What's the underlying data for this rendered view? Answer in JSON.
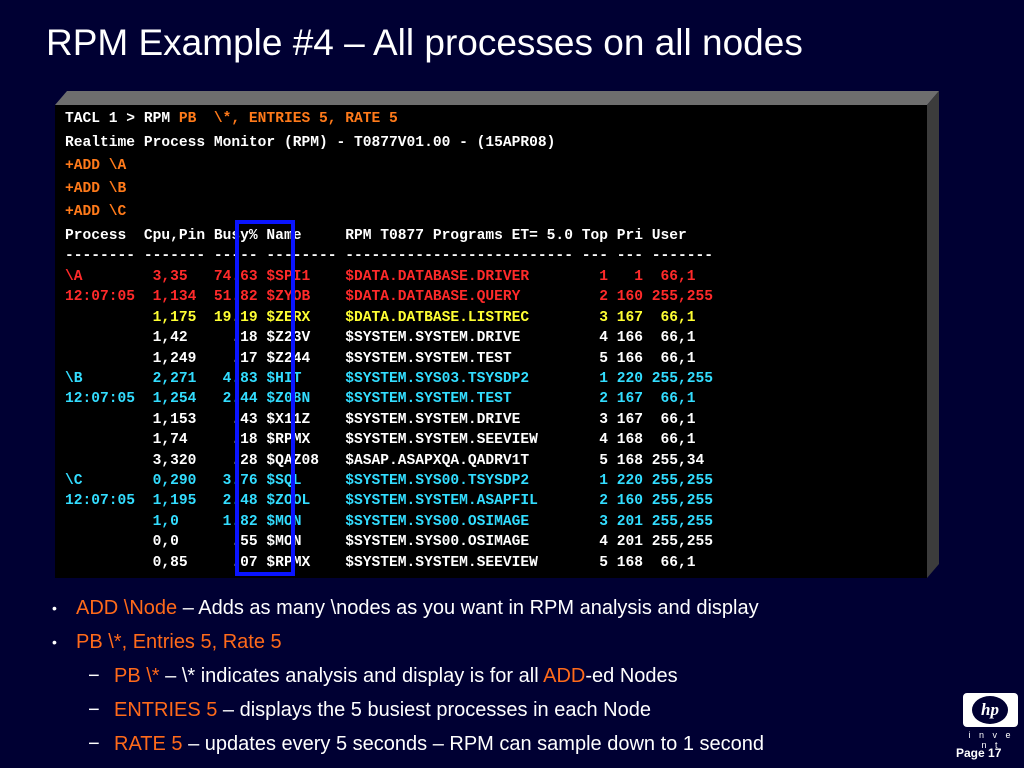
{
  "slide": {
    "title": "RPM Example #4 – All processes on all nodes",
    "page_label": "Page 17",
    "logo_text": "hp",
    "logo_tagline": "i n v e n t"
  },
  "terminal": {
    "prompt": "TACL 1 > RPM ",
    "command_args": "PB  \\*, ENTRIES 5, RATE 5",
    "banner": "Realtime Process Monitor (RPM) - T0877V01.00 - (15APR08)",
    "add_lines": [
      "+ADD \\A",
      "+ADD \\B",
      "+ADD \\C"
    ],
    "header": "Process  Cpu,Pin Busy% Name     RPM T0877 Programs ET= 5.0 Top Pri User",
    "separator": "-------- ------- ----- -------- -------------------------- --- --- -------",
    "rows": [
      {
        "text": "\\A        3,35   74.63 $SPI1    $DATA.DATABASE.DRIVER        1   1  66,1",
        "color": "#ff2a2a"
      },
      {
        "text": "12:07:05  1,134  51.82 $ZYOB    $DATA.DATABASE.QUERY         2 160 255,255",
        "color": "#ff2a2a"
      },
      {
        "text": "          1,175  19.19 $ZERX    $DATA.DATBASE.LISTREC        3 167  66,1",
        "color": "#ffff33"
      },
      {
        "text": "          1,42     .18 $Z23V    $SYSTEM.SYSTEM.DRIVE         4 166  66,1",
        "color": "#ffffff"
      },
      {
        "text": "          1,249    .17 $Z244    $SYSTEM.SYSTEM.TEST          5 166  66,1",
        "color": "#ffffff"
      },
      {
        "text": "\\B        2,271   4.83 $HIT     $SYSTEM.SYS03.TSYSDP2        1 220 255,255",
        "color": "#33ddff"
      },
      {
        "text": "12:07:05  1,254   2.44 $Z08N    $SYSTEM.SYSTEM.TEST          2 167  66,1",
        "color": "#33ddff"
      },
      {
        "text": "          1,153    .43 $X11Z    $SYSTEM.SYSTEM.DRIVE         3 167  66,1",
        "color": "#ffffff"
      },
      {
        "text": "          1,74     .18 $RPMX    $SYSTEM.SYSTEM.SEEVIEW       4 168  66,1",
        "color": "#ffffff"
      },
      {
        "text": "          3,320    .28 $QAZ08   $ASAP.ASAPXQA.QADRV1T        5 168 255,34",
        "color": "#ffffff"
      },
      {
        "text": "\\C        0,290   3.76 $SQL     $SYSTEM.SYS00.TSYSDP2        1 220 255,255",
        "color": "#33ddff"
      },
      {
        "text": "12:07:05  1,195   2.48 $ZOOL    $SYSTEM.SYSTEM.ASAPFIL       2 160 255,255",
        "color": "#33ddff"
      },
      {
        "text": "          1,0     1.82 $MON     $SYSTEM.SYS00.OSIMAGE        3 201 255,255",
        "color": "#33ddff"
      },
      {
        "text": "          0,0      .55 $MON     $SYSTEM.SYS00.OSIMAGE        4 201 255,255",
        "color": "#ffffff"
      },
      {
        "text": "          0,85     .07 $RPMX    $SYSTEM.SYSTEM.SEEVIEW       5 168  66,1",
        "color": "#ffffff"
      }
    ]
  },
  "bullets": [
    {
      "mark": "•",
      "highlight": "ADD \\Node",
      "text": " – Adds as many \\nodes as you want in RPM analysis and display"
    },
    {
      "mark": "•",
      "highlight": "PB \\*, Entries 5, Rate 5",
      "text": ""
    }
  ],
  "sub_bullets": [
    {
      "mark": "−",
      "highlight": "PB \\*",
      "text": " – \\* indicates analysis and display is for all ",
      "highlight2": "ADD",
      "text2": "-ed Nodes"
    },
    {
      "mark": "−",
      "highlight": "ENTRIES 5",
      "text": " – displays the 5 busiest processes in each Node"
    },
    {
      "mark": "−",
      "highlight": "RATE 5",
      "text": " – updates every 5 seconds – RPM can sample down to 1 second"
    }
  ],
  "colors": {
    "background": "#000033",
    "terminal_bg": "#000000",
    "highlight_box": "#0a14ff",
    "bullet_highlight": "#ff6a1a"
  }
}
